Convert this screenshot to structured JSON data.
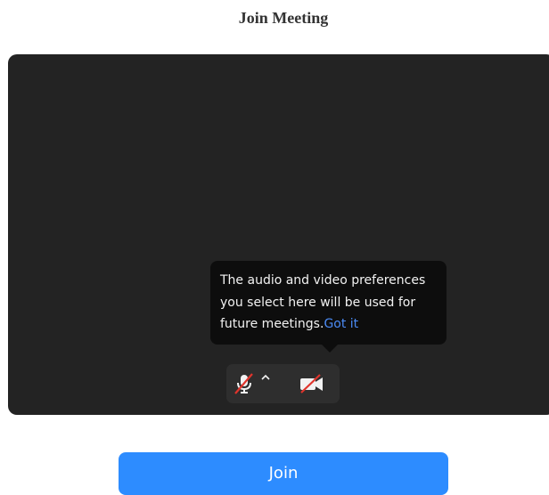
{
  "page": {
    "title": "Join Meeting"
  },
  "tooltip": {
    "line1": "The audio and video preferences",
    "line2": "you select here will be used for",
    "line3_text": "future meetings.",
    "link_label": "Got it"
  },
  "controls": {
    "mic_icon": "microphone-muted-icon",
    "audio_menu_icon": "caret-up-icon",
    "video_icon": "video-camera-off-icon"
  },
  "join_button": {
    "label": "Join"
  },
  "colors": {
    "preview_background": "#232323",
    "tooltip_background": "#0d0d0d",
    "link": "#4b8bf5",
    "join_button": "#2d8cff",
    "muted_slash": "#e0342c"
  }
}
